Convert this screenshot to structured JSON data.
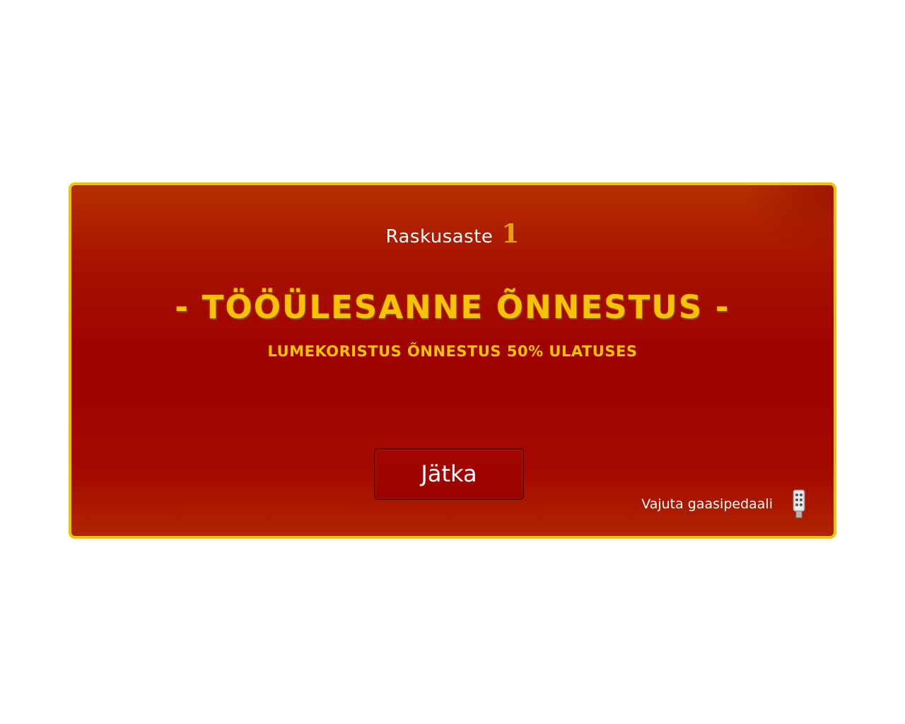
{
  "level": {
    "label": "Raskusaste",
    "value": "1"
  },
  "result": {
    "title": "- TÖÖÜLESANNE ÕNNESTUS -",
    "detail": "LUMEKORISTUS ÕNNESTUS 50% ULATUSES"
  },
  "actions": {
    "continue_label": "Jätka",
    "hint": "Vajuta gaasipedaali",
    "hint_icon": "gas-pedal-icon"
  },
  "colors": {
    "panel_background": "#a00400",
    "panel_border": "#f2c200",
    "headline_text": "#f7c300",
    "level_number": "#e1a20e",
    "button_border": "#5c0e00"
  }
}
